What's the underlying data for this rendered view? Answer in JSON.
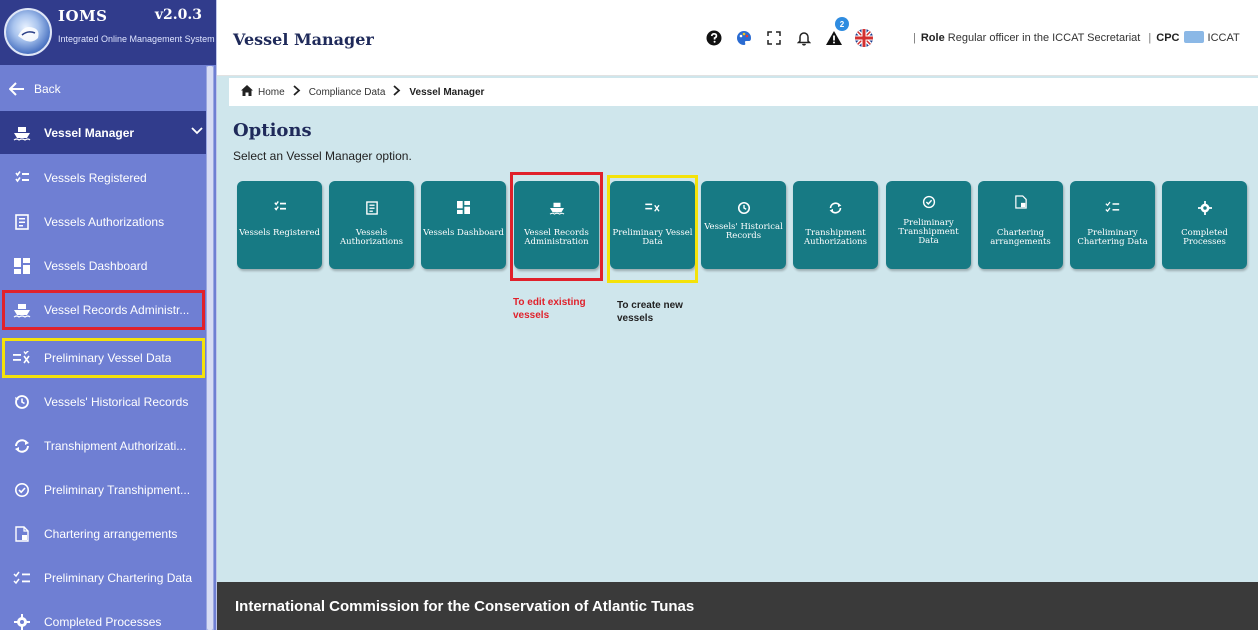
{
  "brand": {
    "name": "IOMS",
    "version": "v2.0.3",
    "subtitle": "Integrated Online Management System"
  },
  "sidebar": {
    "back_label": "Back",
    "active_section": "Vessel Manager",
    "items": [
      {
        "label": "Vessels Registered",
        "icon": "vessels-registered-icon"
      },
      {
        "label": "Vessels Authorizations",
        "icon": "authorizations-icon"
      },
      {
        "label": "Vessels Dashboard",
        "icon": "dashboard-icon"
      },
      {
        "label": "Vessel Records Administr...",
        "icon": "ship-icon"
      },
      {
        "label": "Preliminary Vessel Data",
        "icon": "list-x-icon"
      },
      {
        "label": "Vessels' Historical Records",
        "icon": "history-icon"
      },
      {
        "label": "Transhipment Authorizati...",
        "icon": "transfer-icon"
      },
      {
        "label": "Preliminary Transhipment...",
        "icon": "refresh-check-icon"
      },
      {
        "label": "Chartering arrangements",
        "icon": "document-icon"
      },
      {
        "label": "Preliminary Chartering Data",
        "icon": "checklist-icon"
      },
      {
        "label": "Completed Processes",
        "icon": "gear-icon"
      }
    ]
  },
  "header": {
    "title": "Vessel Manager",
    "notification_count": "2",
    "role_label": "Role",
    "role_value": "Regular officer in the ICCAT Secretariat",
    "cpc_label": "CPC",
    "cpc_value": "ICCAT"
  },
  "breadcrumb": {
    "home": "Home",
    "level1": "Compliance Data",
    "current": "Vessel Manager"
  },
  "options": {
    "title": "Options",
    "subtitle": "Select an Vessel Manager option.",
    "tiles": [
      {
        "label": "Vessels Registered"
      },
      {
        "label": "Vessels Authorizations"
      },
      {
        "label": "Vessels Dashboard"
      },
      {
        "label": "Vessel Records Administration"
      },
      {
        "label": "Preliminary Vessel Data"
      },
      {
        "label": "Vessels' Historical Records"
      },
      {
        "label": "Transhipment Authorizations"
      },
      {
        "label": "Preliminary Transhipment Data"
      },
      {
        "label": "Chartering arrangements"
      },
      {
        "label": "Preliminary Chartering Data"
      },
      {
        "label": "Completed Processes"
      }
    ]
  },
  "annotations": {
    "edit_note": "To edit existing vessels",
    "create_note": "To create new vessels"
  },
  "footer": {
    "text": "International Commission for the Conservation of Atlantic Tunas"
  },
  "colors": {
    "sidebar": "#6f7fd3",
    "sidebar_dark": "#313c8c",
    "tile": "#177a84",
    "main_bg": "#cfe6ec",
    "highlight_red": "#e0212b",
    "highlight_yellow": "#f4e20a"
  }
}
